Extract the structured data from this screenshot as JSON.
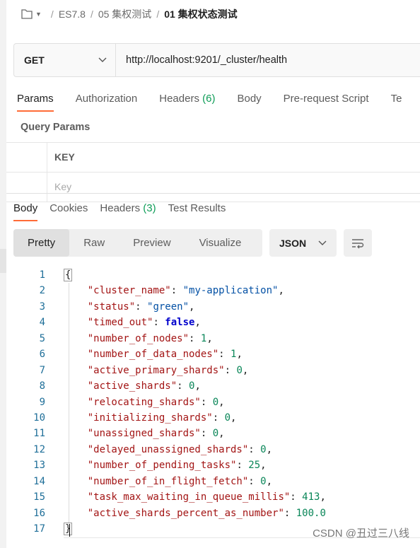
{
  "breadcrumb": {
    "items": [
      "ES7.8",
      "05 集权测试"
    ],
    "current": "01 集权状态测试"
  },
  "request": {
    "method": "GET",
    "url": "http://localhost:9201/_cluster/health"
  },
  "request_tabs": [
    {
      "label": "Params",
      "badge": ""
    },
    {
      "label": "Authorization",
      "badge": ""
    },
    {
      "label": "Headers",
      "badge": "(6)"
    },
    {
      "label": "Body",
      "badge": ""
    },
    {
      "label": "Pre-request Script",
      "badge": ""
    },
    {
      "label": "Te",
      "badge": ""
    }
  ],
  "query_params": {
    "title": "Query Params",
    "key_header": "KEY",
    "key_placeholder": "Key"
  },
  "response_tabs": [
    {
      "label": "Body",
      "badge": ""
    },
    {
      "label": "Cookies",
      "badge": ""
    },
    {
      "label": "Headers",
      "badge": "(3)"
    },
    {
      "label": "Test Results",
      "badge": ""
    }
  ],
  "view_tabs": [
    "Pretty",
    "Raw",
    "Preview",
    "Visualize"
  ],
  "format": {
    "selected": "JSON"
  },
  "colors": {
    "accent": "#ff6c37",
    "badge_green": "#0f9d58",
    "key_red": "#a31515",
    "string_blue": "#0451a5",
    "number_green": "#098658"
  },
  "code_lines": [
    {
      "n": "1",
      "kind": "open",
      "text": "{"
    },
    {
      "n": "2",
      "kind": "pair",
      "key": "\"cluster_name\"",
      "vtype": "s",
      "value": "\"my-application\"",
      "tail": ","
    },
    {
      "n": "3",
      "kind": "pair",
      "key": "\"status\"",
      "vtype": "s",
      "value": "\"green\"",
      "tail": ","
    },
    {
      "n": "4",
      "kind": "pair",
      "key": "\"timed_out\"",
      "vtype": "b",
      "value": "false",
      "tail": ","
    },
    {
      "n": "5",
      "kind": "pair",
      "key": "\"number_of_nodes\"",
      "vtype": "n",
      "value": "1",
      "tail": ","
    },
    {
      "n": "6",
      "kind": "pair",
      "key": "\"number_of_data_nodes\"",
      "vtype": "n",
      "value": "1",
      "tail": ","
    },
    {
      "n": "7",
      "kind": "pair",
      "key": "\"active_primary_shards\"",
      "vtype": "n",
      "value": "0",
      "tail": ","
    },
    {
      "n": "8",
      "kind": "pair",
      "key": "\"active_shards\"",
      "vtype": "n",
      "value": "0",
      "tail": ","
    },
    {
      "n": "9",
      "kind": "pair",
      "key": "\"relocating_shards\"",
      "vtype": "n",
      "value": "0",
      "tail": ","
    },
    {
      "n": "10",
      "kind": "pair",
      "key": "\"initializing_shards\"",
      "vtype": "n",
      "value": "0",
      "tail": ","
    },
    {
      "n": "11",
      "kind": "pair",
      "key": "\"unassigned_shards\"",
      "vtype": "n",
      "value": "0",
      "tail": ","
    },
    {
      "n": "12",
      "kind": "pair",
      "key": "\"delayed_unassigned_shards\"",
      "vtype": "n",
      "value": "0",
      "tail": ","
    },
    {
      "n": "13",
      "kind": "pair",
      "key": "\"number_of_pending_tasks\"",
      "vtype": "n",
      "value": "25",
      "tail": ","
    },
    {
      "n": "14",
      "kind": "pair",
      "key": "\"number_of_in_flight_fetch\"",
      "vtype": "n",
      "value": "0",
      "tail": ","
    },
    {
      "n": "15",
      "kind": "pair",
      "key": "\"task_max_waiting_in_queue_millis\"",
      "vtype": "n",
      "value": "413",
      "tail": ","
    },
    {
      "n": "16",
      "kind": "pair",
      "key": "\"active_shards_percent_as_number\"",
      "vtype": "n",
      "value": "100.0",
      "tail": ""
    },
    {
      "n": "17",
      "kind": "close",
      "text": "}"
    }
  ],
  "watermark": "CSDN @丑过三八线"
}
